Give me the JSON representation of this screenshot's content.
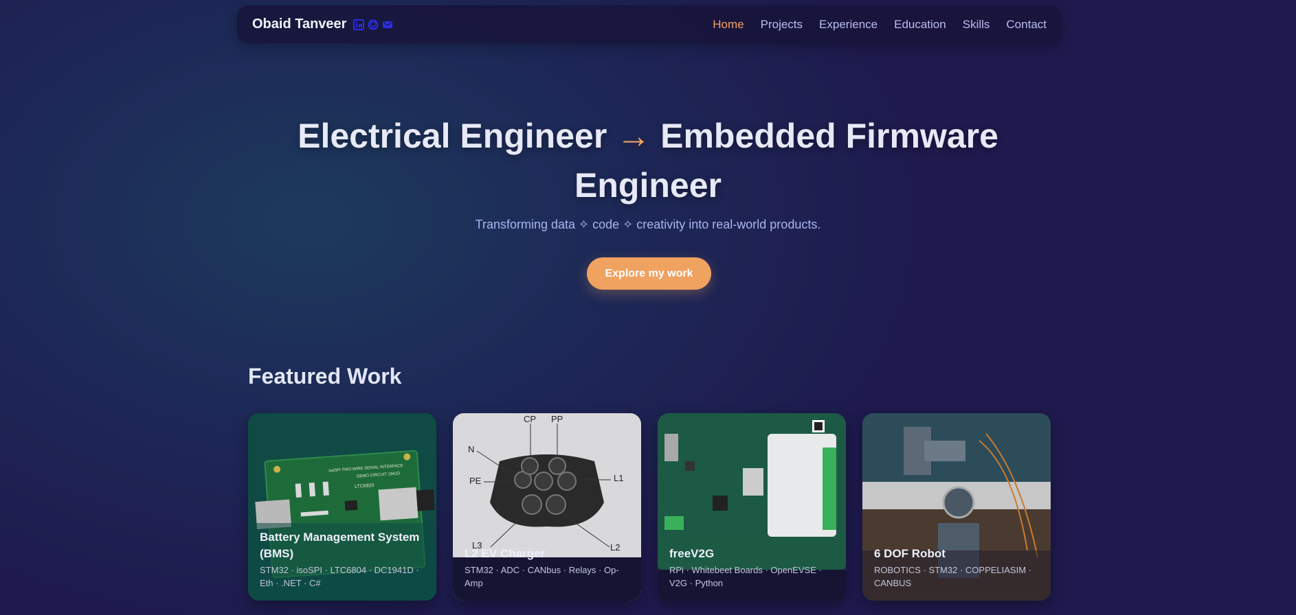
{
  "nav": {
    "brand": "Obaid Tanveer",
    "icons": [
      "linkedin-icon",
      "github-icon",
      "mail-icon"
    ],
    "links": [
      "Home",
      "Projects",
      "Experience",
      "Education",
      "Skills",
      "Contact"
    ],
    "active": "Home"
  },
  "hero": {
    "title_part1": "Electrical Engineer",
    "arrow": "→",
    "title_part2": "Embedded Firmware",
    "title_line2": "Engineer",
    "subtitle": "Transforming data ✧ code ✧ creativity into real-world products.",
    "cta": "Explore my work"
  },
  "featured": {
    "title": "Featured Work",
    "cards": [
      {
        "title": "Battery Management System (BMS)",
        "tags": "STM32 · isoSPI · LTC6804 · DC1941D · Eth · .NET · C#"
      },
      {
        "title": "L2 EV Charger",
        "tags": "STM32 · ADC · CANbus · Relays · Op-Amp"
      },
      {
        "title": "freeV2G",
        "tags": "RPi · Whitebeet Boards · OpenEVSE · V2G · Python"
      },
      {
        "title": "6 DOF Robot",
        "tags": "ROBOTICS · STM32 · COPPELIASIM · CANBUS"
      }
    ],
    "image_labels": {
      "pcb_board": [
        "isoSPI TWO WIRE SERIAL INTERFACE",
        "DEMO CIRCUIT 1941D",
        "LTC6820"
      ],
      "connector_pins": [
        "CP",
        "PP",
        "N",
        "PE",
        "L1",
        "L3",
        "L2"
      ]
    }
  },
  "colors": {
    "accent": "#f2a464",
    "nav_link": "#b9bef0",
    "background": "#1e1a4d"
  }
}
